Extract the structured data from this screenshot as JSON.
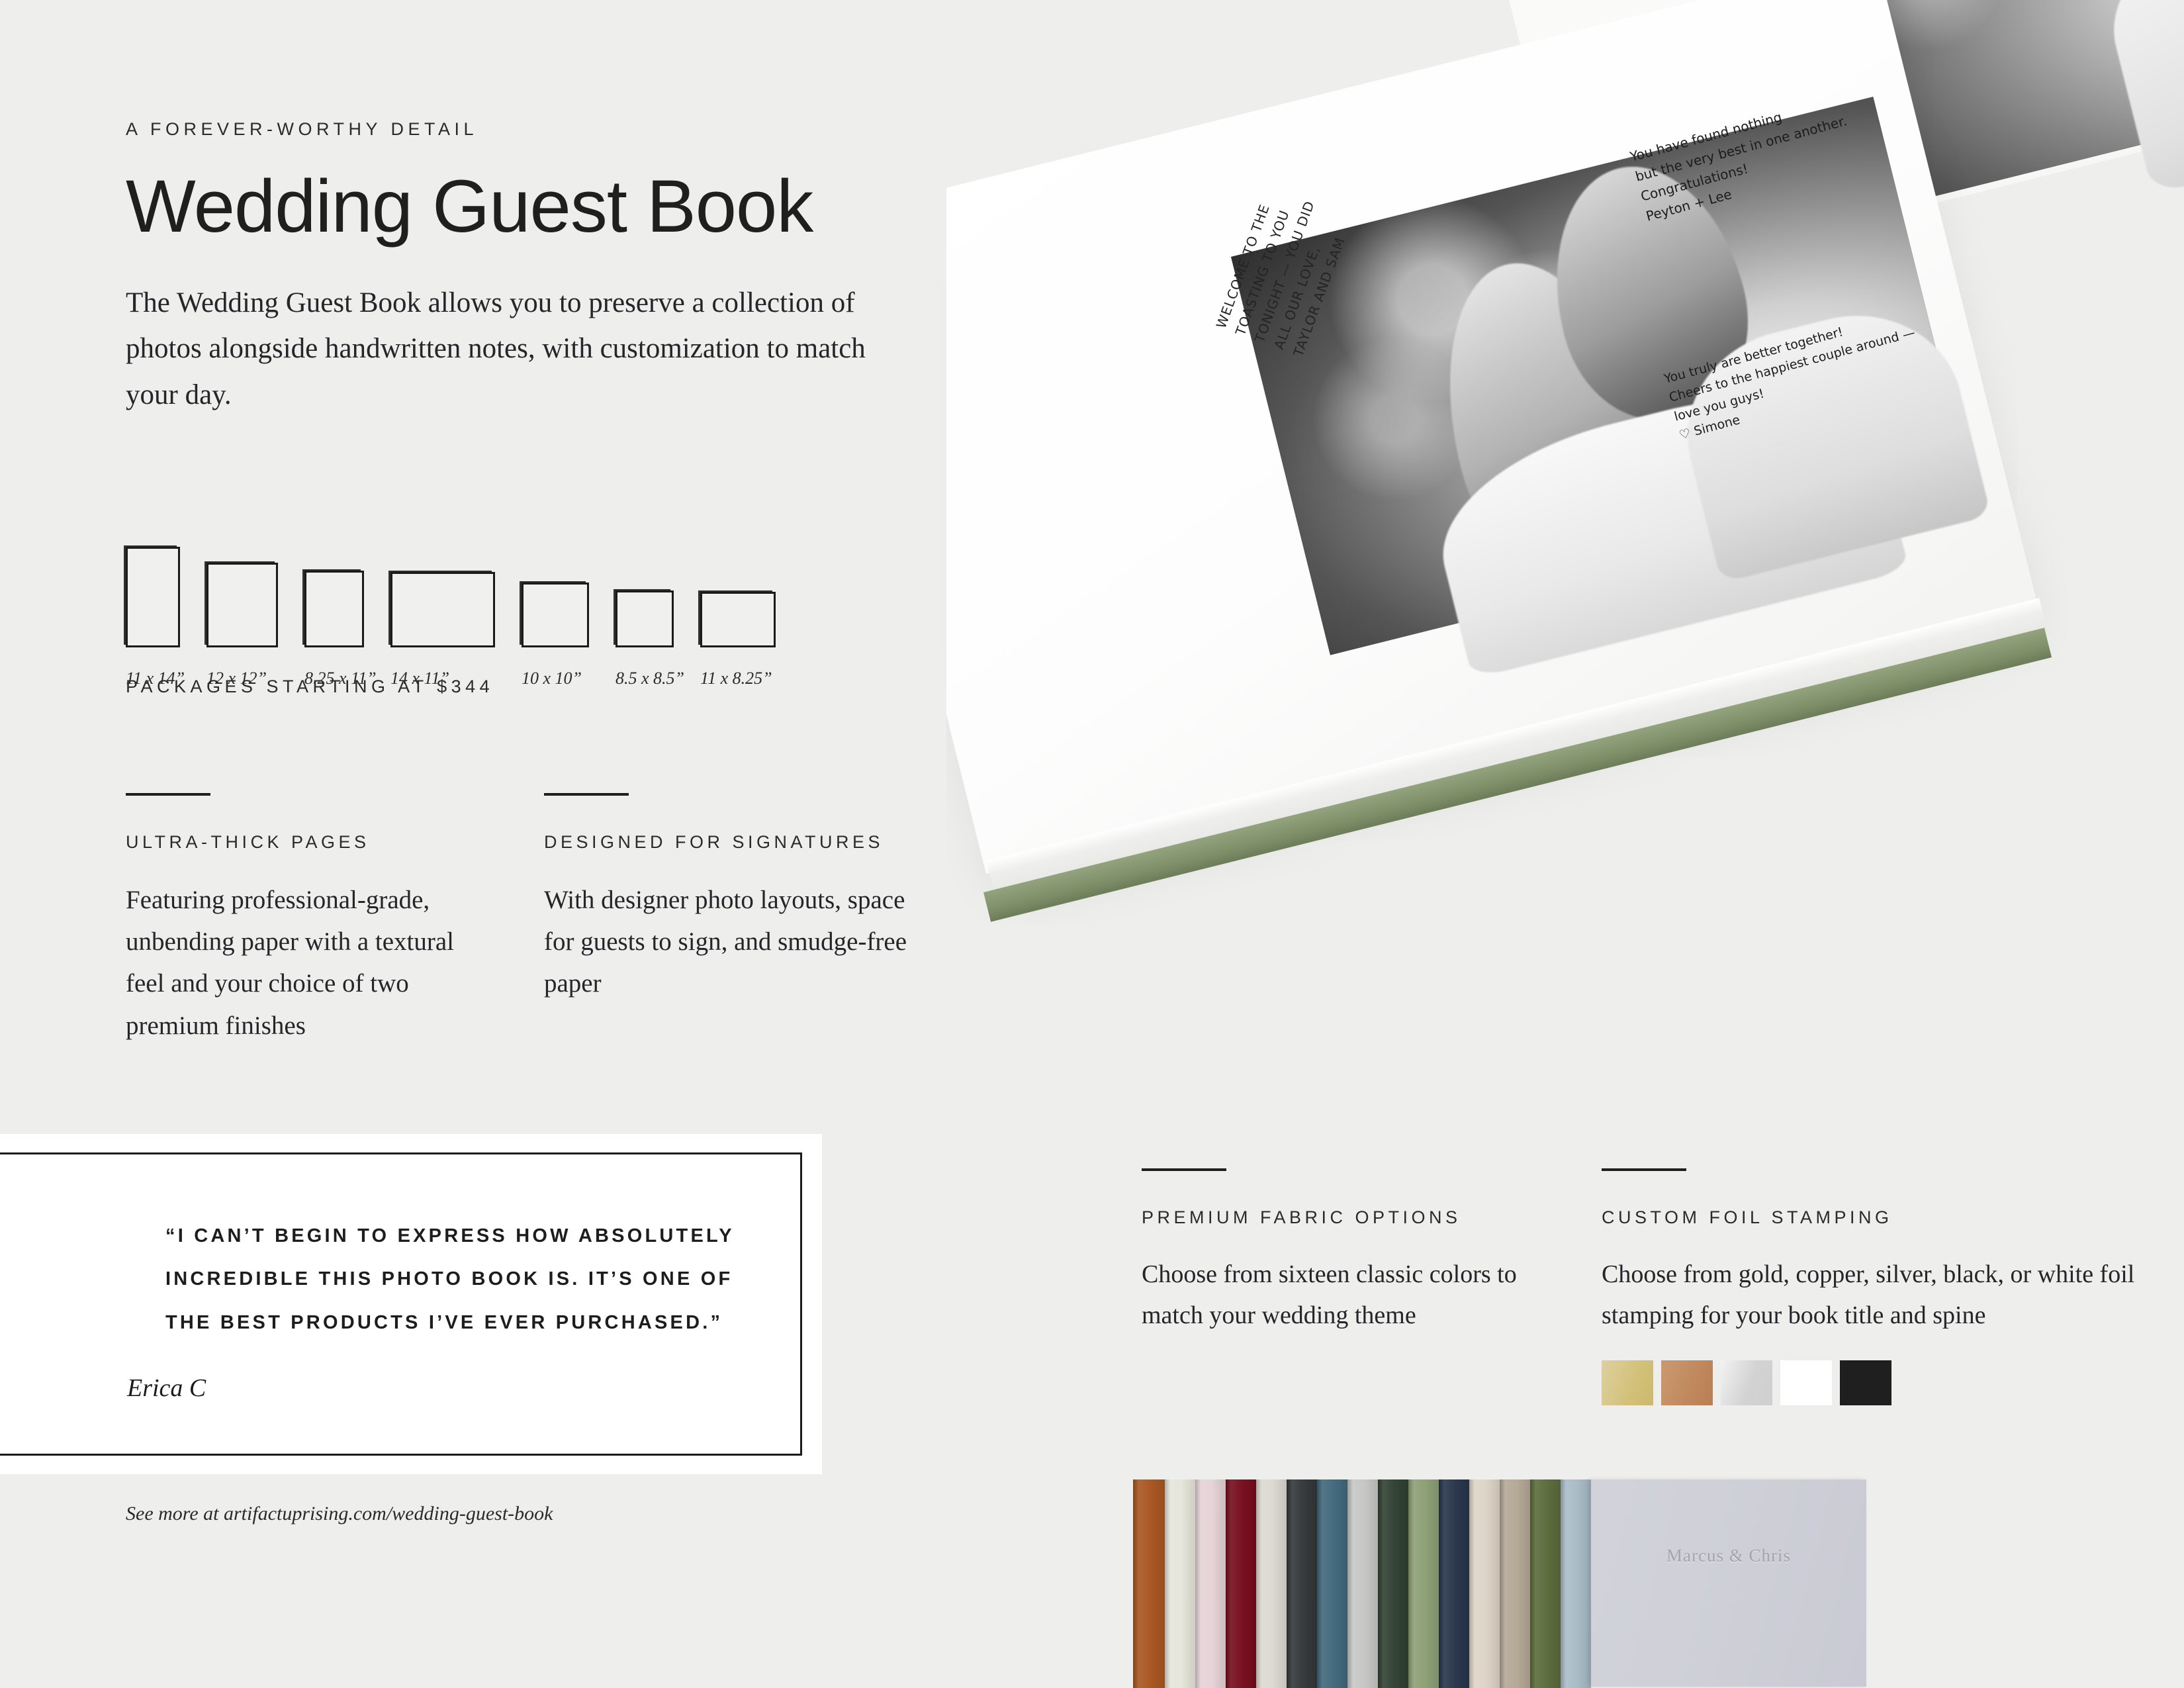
{
  "header": {
    "eyebrow": "A FOREVER-WORTHY DETAIL",
    "title": "Wedding Guest Book",
    "intro": "The Wedding Guest Book allows you to preserve a collection of photos alongside handwritten notes, with customization to match your day."
  },
  "sizes": {
    "label": "PACKAGES STARTING AT $344",
    "items": [
      {
        "label": "11 x 14”",
        "w": 82,
        "h": 152
      },
      {
        "label": "12 x 12”",
        "w": 108,
        "h": 128
      },
      {
        "label": "8.25 x 11”",
        "w": 90,
        "h": 116
      },
      {
        "label": "14 x 11”",
        "w": 158,
        "h": 114
      },
      {
        "label": "10 x 10”",
        "w": 102,
        "h": 98
      },
      {
        "label": "8.5 x 8.5”",
        "w": 88,
        "h": 86
      },
      {
        "label": "11 x 8.25”",
        "w": 114,
        "h": 84
      }
    ]
  },
  "features": {
    "pages": {
      "title": "ULTRA-THICK PAGES",
      "body": "Featuring professional-grade, unbending paper with a textural feel and your choice of two premium finishes"
    },
    "signatures": {
      "title": "DESIGNED FOR SIGNATURES",
      "body": "With designer photo layouts, space for guests to sign, and smudge-free paper"
    },
    "fabric": {
      "title": "PREMIUM FABRIC OPTIONS",
      "body": "Choose from sixteen classic colors to match your wedding theme"
    },
    "foil": {
      "title": "CUSTOM FOIL STAMPING",
      "body": "Choose from gold, copper, silver, black, or white foil stamping for your book title and spine"
    }
  },
  "foil_swatches": [
    {
      "name": "gold",
      "color": "#d6c687"
    },
    {
      "name": "copper",
      "color": "#c28a5f"
    },
    {
      "name": "silver",
      "color": "#dcdcdc"
    },
    {
      "name": "white",
      "color": "#ffffff"
    },
    {
      "name": "black",
      "color": "#1f1f1f"
    }
  ],
  "testimonial": {
    "quote": "“I CAN’T BEGIN TO EXPRESS HOW ABSOLUTELY INCREDIBLE THIS PHOTO BOOK IS. IT’S ONE OF THE BEST PRODUCTS I’VE EVER PURCHASED.”",
    "attribution": "Erica C"
  },
  "footer": {
    "link": "See more at artifactuprising.com/wedding-guest-book"
  },
  "hero": {
    "cover_color": "#7f9069",
    "embossed_title": "Marcus & Chris",
    "notes": {
      "top": "You have found nothing\nbut the very best in one another.\nCongratulations!\nPeyton + Lee",
      "left": "WELCOME TO THE\nTOASTING TO YOU\nTONIGHT — YOU DID\nALL OUR LOVE,\nTAYLOR AND SAM",
      "bottom": "You truly are better together!\nCheers to the happiest couple around —\nlove you guys!\n♡ Simone"
    }
  },
  "fabric_books": {
    "spines": [
      {
        "name": "rust",
        "color": "#a9551f",
        "width": 48
      },
      {
        "name": "cream",
        "color": "#e6e5da",
        "width": 46
      },
      {
        "name": "blush",
        "color": "#e5d3d6",
        "width": 46
      },
      {
        "name": "burgundy",
        "color": "#760c1c",
        "width": 46
      },
      {
        "name": "oat",
        "color": "#dbd9d0",
        "width": 46
      },
      {
        "name": "charcoal",
        "color": "#333739",
        "width": 46
      },
      {
        "name": "teal",
        "color": "#40687c",
        "width": 46
      },
      {
        "name": "pale-gray",
        "color": "#c6c7c4",
        "width": 46
      },
      {
        "name": "forest-green",
        "color": "#2f4132",
        "width": 46
      },
      {
        "name": "sage",
        "color": "#8c9f75",
        "width": 46
      },
      {
        "name": "navy",
        "color": "#27344b",
        "width": 46
      },
      {
        "name": "sand",
        "color": "#ddd4c6",
        "width": 46
      },
      {
        "name": "taupe",
        "color": "#b4a896",
        "width": 46
      },
      {
        "name": "olive",
        "color": "#5b6b3b",
        "width": 46
      },
      {
        "name": "dusty-blue",
        "color": "#a8bcc6",
        "width": 46
      }
    ]
  }
}
